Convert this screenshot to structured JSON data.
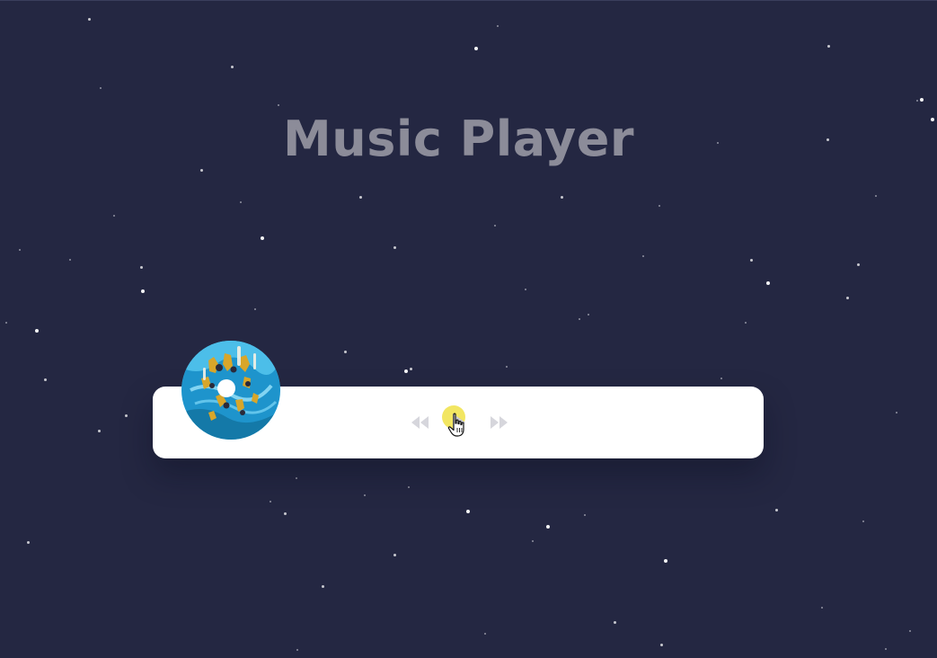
{
  "page": {
    "title": "Music Player",
    "background_color": "#242742",
    "title_color": "#8c8c99"
  },
  "player": {
    "album_art": {
      "icon": "album-disc-icon",
      "description_colors": [
        "#1a9fd6",
        "#47c4f0",
        "#d8a62a"
      ]
    },
    "controls": {
      "prev": {
        "icon": "rewind-icon"
      },
      "play": {
        "icon": "play-icon"
      },
      "next": {
        "icon": "fast-forward-icon"
      }
    },
    "card_color": "#ffffff",
    "control_color": "#d6d6dc",
    "click_highlight_color": "#f0e246"
  },
  "cursor": {
    "icon": "hand-pointer-icon"
  }
}
